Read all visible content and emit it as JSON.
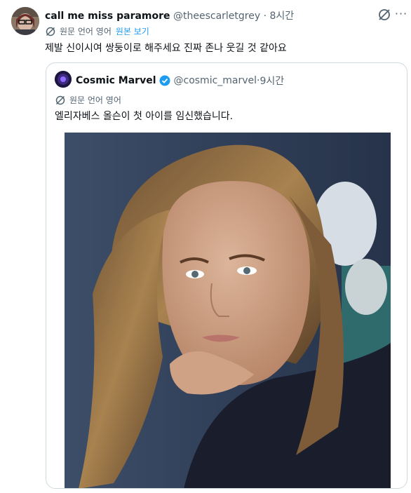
{
  "tweet": {
    "display_name": "call me miss paramore",
    "handle": "@theescarletgrey",
    "separator": "·",
    "time": "8시간",
    "translate_label": "원문 언어 영어",
    "show_original": "원본 보기",
    "text": "제발 신이시여 쌍둥이로 해주세요 진짜 존나 웃길 것 같아요"
  },
  "quoted": {
    "display_name": "Cosmic Marvel",
    "handle": "@cosmic_marvel",
    "separator": "·",
    "time": "9시간",
    "translate_label": "원문 언어 영어",
    "text": "엘리자베스 올슨이 첫 아이를 임신했습니다.",
    "verified_color": "#1d9bf0"
  },
  "icons": [
    "grok-icon",
    "more-icon",
    "translate-icon",
    "verified-icon"
  ],
  "colors": {
    "link": "#1d9bf0",
    "secondary": "#536471",
    "border": "#cfd9de"
  }
}
